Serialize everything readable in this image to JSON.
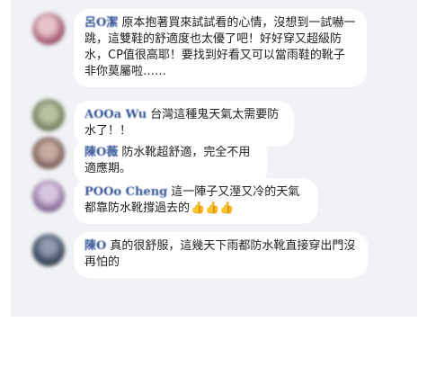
{
  "comments": [
    {
      "author": "呂O潔",
      "text": "原本抱著買來試試看的心情，沒想到一試嚇一跳，這雙鞋的舒適度也太優了吧！好好穿又超級防水，CP值很高耶！要找到好看又可以當雨鞋的靴子非你莫屬啦……",
      "avatar_color": "#a8627a"
    },
    {
      "author": "AOOa Wu",
      "text": "台灣這種鬼天氣太需要防水了！！",
      "avatar_color": "#6f7d5c"
    },
    {
      "author": "陳O薇",
      "text": "防水靴超舒適，完全不用適應期。",
      "avatar_color": "#7a5f5a"
    },
    {
      "author": "POOo Cheng",
      "text": "這一陣子又溼又冷的天氣都靠防水靴撐過去的",
      "emoji": "👍👍👍",
      "avatar_color": "#8c6f9a"
    },
    {
      "author": "陳O",
      "text": "真的很舒服，這幾天下雨都防水靴直接穿出門沒再怕的",
      "avatar_color": "#3e4a5c"
    }
  ]
}
